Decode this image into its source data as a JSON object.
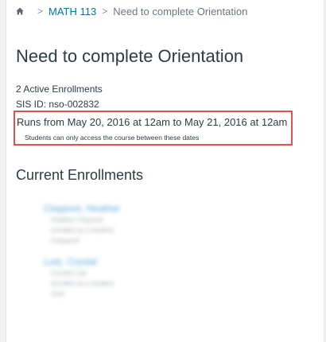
{
  "breadcrumb": {
    "home_icon": "home-icon",
    "items": [
      "MATH 113",
      "Need to complete Orientation"
    ]
  },
  "page": {
    "title": "Need to complete Orientation",
    "active_enrollments": "2 Active Enrollments",
    "sis_id": "SIS ID: nso-002832",
    "runs": "Runs from May 20, 2016 at 12am to May 21, 2016 at 12am",
    "runs_note": "Students can only access the course between these dates"
  },
  "enrollments_section": {
    "title": "Current Enrollments",
    "items": [
      {
        "name": "Claypool, Heather",
        "lines": [
          "Heather Claypool",
          "enrolled as a student",
          "hclaypool"
        ]
      },
      {
        "name": "Lutz, Crystal",
        "lines": [
          "Crystal Lutz",
          "enrolled as a student",
          "clutz"
        ]
      }
    ]
  },
  "colors": {
    "link": "#0770a3",
    "highlight_border": "#d9534f",
    "text": "#2d3b45"
  }
}
